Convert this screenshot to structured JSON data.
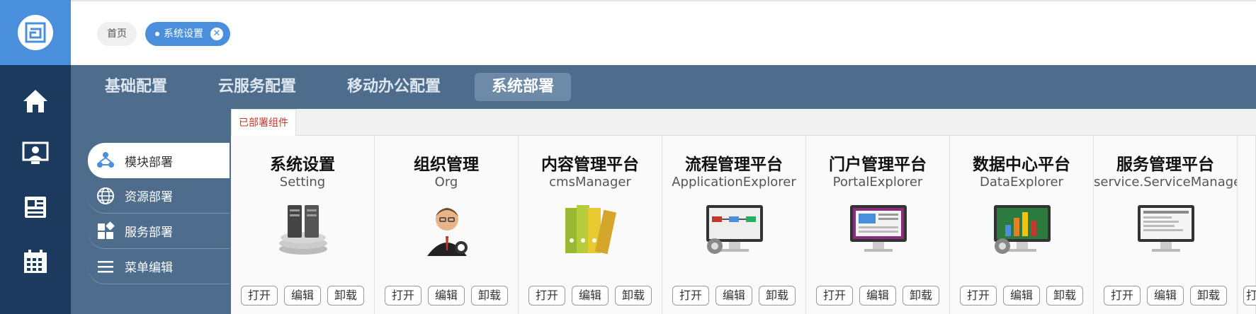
{
  "breadcrumbs": [
    {
      "label": "首页"
    },
    {
      "label": "系统设置",
      "active": true
    }
  ],
  "rail": {
    "icons": [
      "home-icon",
      "user-screen-icon",
      "news-icon",
      "calendar-icon"
    ],
    "colors": {
      "rail": "#1c3a5e",
      "logo_bg": "#4a8fdc"
    }
  },
  "tabs": [
    {
      "label": "基础配置"
    },
    {
      "label": "云服务配置"
    },
    {
      "label": "移动办公配置"
    },
    {
      "label": "系统部署",
      "active": true
    }
  ],
  "side_menu": [
    {
      "label": "模块部署",
      "icon": "module-icon",
      "active": true
    },
    {
      "label": "资源部署",
      "icon": "globe-icon"
    },
    {
      "label": "服务部署",
      "icon": "blocks-icon"
    },
    {
      "label": "菜单编辑",
      "icon": "menu-icon"
    }
  ],
  "panel": {
    "tab_label": "已部署组件",
    "buttons": {
      "open": "打开",
      "edit": "编辑",
      "uninstall": "卸载",
      "partial": "打"
    },
    "cards": [
      {
        "title": "系统设置",
        "subtitle": "Setting",
        "image": "server-image"
      },
      {
        "title": "组织管理",
        "subtitle": "Org",
        "image": "person-image"
      },
      {
        "title": "内容管理平台",
        "subtitle": "cmsManager",
        "image": "binders-image"
      },
      {
        "title": "流程管理平台",
        "subtitle": "ApplicationExplorer",
        "image": "workflow-monitor-image"
      },
      {
        "title": "门户管理平台",
        "subtitle": "PortalExplorer",
        "image": "portal-monitor-image"
      },
      {
        "title": "数据中心平台",
        "subtitle": "DataExplorer",
        "image": "data-monitor-image"
      },
      {
        "title": "服务管理平台",
        "subtitle": "service.ServiceManage",
        "image": "service-monitor-image"
      }
    ]
  },
  "colors": {
    "main_bg": "#4e6d8c",
    "accent": "#4a8fdc",
    "panel_tab_text": "#c0392b"
  }
}
